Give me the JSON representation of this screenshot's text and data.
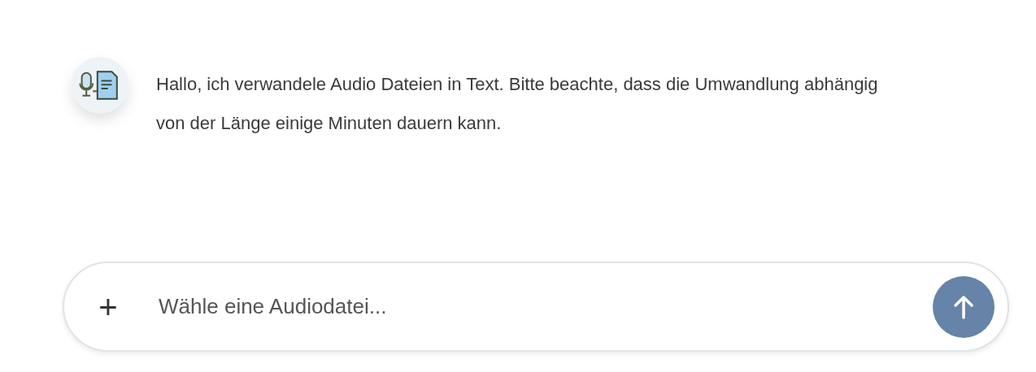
{
  "messages": [
    {
      "text": "Hallo, ich verwandele Audio Dateien in Text. Bitte beachte, dass die Umwandlung abhängig von der Länge einige Minuten dauern kann."
    }
  ],
  "composer": {
    "attach_label": "+",
    "placeholder": "Wähle eine Audiodatei..."
  }
}
